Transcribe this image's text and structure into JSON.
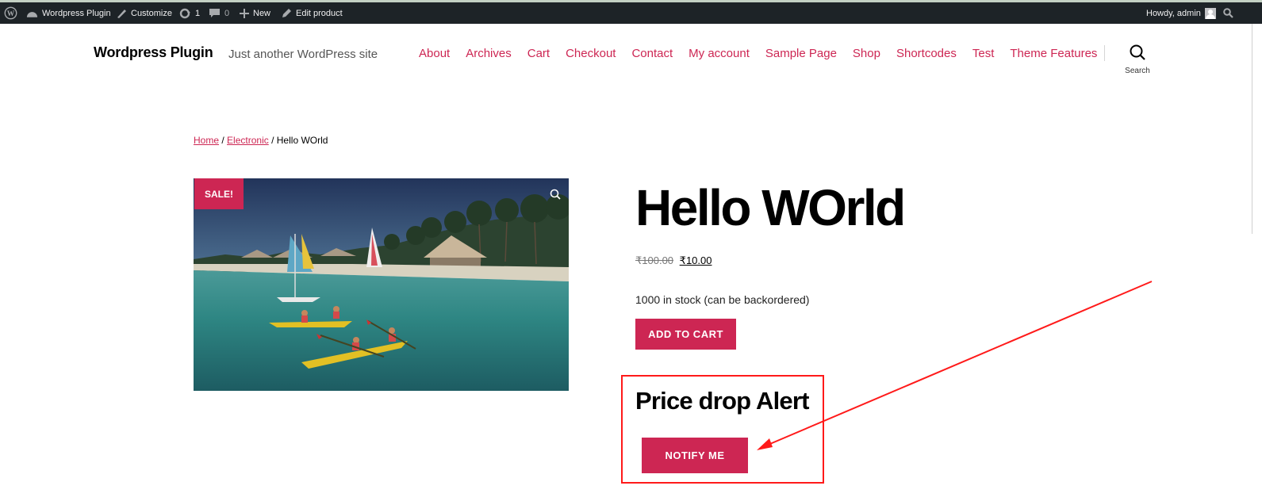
{
  "admin_bar": {
    "site_name": "Wordpress Plugin",
    "customize": "Customize",
    "updates_count": "1",
    "comments_count": "0",
    "new_label": "New",
    "edit_label": "Edit product",
    "howdy": "Howdy, admin"
  },
  "header": {
    "site_title": "Wordpress Plugin",
    "tagline": "Just another WordPress site",
    "nav": [
      "About",
      "Archives",
      "Cart",
      "Checkout",
      "Contact",
      "My account",
      "Sample Page",
      "Shop",
      "Shortcodes",
      "Test",
      "Theme Features"
    ],
    "search_label": "Search"
  },
  "breadcrumb": {
    "home": "Home",
    "category": "Electronic",
    "separator": "/",
    "current": "Hello WOrld"
  },
  "product": {
    "sale_badge": "SALE!",
    "title": "Hello WOrld",
    "regular_price": "₹100.00",
    "sale_price": "₹10.00",
    "stock": "1000 in stock (can be backordered)",
    "add_to_cart": "ADD TO CART",
    "alert_heading": "Price drop Alert",
    "notify_button": "NOTIFY ME"
  },
  "colors": {
    "accent": "#cd2653",
    "admin_bar": "#1d2327",
    "annotation": "#ff1a1a"
  }
}
